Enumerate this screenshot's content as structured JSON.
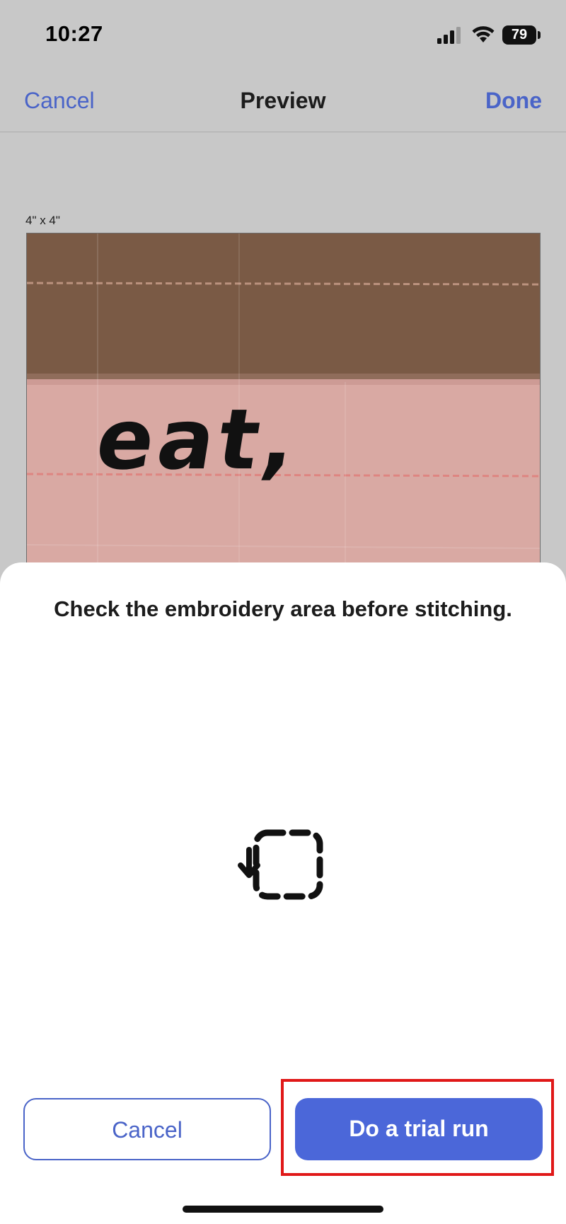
{
  "status_bar": {
    "time": "10:27",
    "battery_level": "79",
    "icons": [
      "cellular-signal-icon",
      "wifi-icon",
      "battery-icon"
    ]
  },
  "nav_bar": {
    "cancel_label": "Cancel",
    "title": "Preview",
    "done_label": "Done"
  },
  "preview": {
    "hoop_size": "4\" x 4\"",
    "embroidery_text": "eat,"
  },
  "sheet": {
    "message": "Check the embroidery area before stitching.",
    "icon": "trace-area-icon",
    "cancel_label": "Cancel",
    "trial_run_label": "Do a trial run"
  },
  "colors": {
    "accent": "#4a64c8",
    "primary_button": "#4b67d9",
    "highlight": "#e01818",
    "fabric_top": "#7a5a45",
    "fabric_bottom": "#d9a9a3"
  }
}
